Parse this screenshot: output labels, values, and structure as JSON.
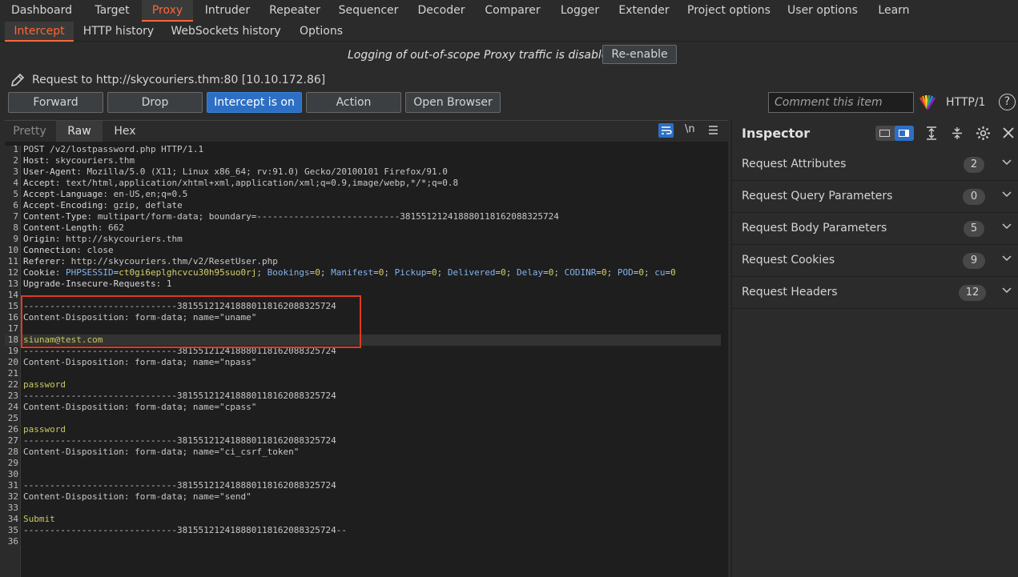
{
  "main_tabs": [
    "Dashboard",
    "Target",
    "Proxy",
    "Intruder",
    "Repeater",
    "Sequencer",
    "Decoder",
    "Comparer",
    "Logger",
    "Extender",
    "Project options",
    "User options",
    "Learn"
  ],
  "sub_tabs": [
    "Intercept",
    "HTTP history",
    "WebSockets history",
    "Options"
  ],
  "logging": {
    "text": "Logging of out-of-scope Proxy traffic is disabled",
    "reenable": "Re-enable"
  },
  "request_info": "Request to http://skycouriers.thm:80  [10.10.172.86]",
  "toolbar": {
    "forward": "Forward",
    "drop": "Drop",
    "intercept": "Intercept is on",
    "action": "Action",
    "open_browser": "Open Browser",
    "comment_placeholder": "Comment this item",
    "http_version": "HTTP/1",
    "help": "?"
  },
  "editor_tabs": [
    "Pretty",
    "Raw",
    "Hex"
  ],
  "editor_tools": {
    "newline": "\\n"
  },
  "request": {
    "request_line": "POST /v2/lostpassword.php HTTP/1.1",
    "headers": [
      {
        "k": "Host",
        "v": "skycouriers.thm"
      },
      {
        "k": "User-Agent",
        "v": "Mozilla/5.0 (X11; Linux x86_64; rv:91.0) Gecko/20100101 Firefox/91.0"
      },
      {
        "k": "Accept",
        "v": "text/html,application/xhtml+xml,application/xml;q=0.9,image/webp,*/*;q=0.8"
      },
      {
        "k": "Accept-Language",
        "v": "en-US,en;q=0.5"
      },
      {
        "k": "Accept-Encoding",
        "v": "gzip, deflate"
      },
      {
        "k": "Content-Type",
        "v": "multipart/form-data; boundary=---------------------------381551212418880118162088325724"
      },
      {
        "k": "Content-Length",
        "v": "662"
      },
      {
        "k": "Origin",
        "v": "http://skycouriers.thm"
      },
      {
        "k": "Connection",
        "v": "close"
      },
      {
        "k": "Referer",
        "v": "http://skycouriers.thm/v2/ResetUser.php"
      }
    ],
    "cookie_key": "Cookie",
    "cookies": [
      {
        "k": "PHPSESSID",
        "v": "ct0gi6eplghcvcu30h95suo0rj"
      },
      {
        "k": "Bookings",
        "v": "0"
      },
      {
        "k": "Manifest",
        "v": "0"
      },
      {
        "k": "Pickup",
        "v": "0"
      },
      {
        "k": "Delivered",
        "v": "0"
      },
      {
        "k": "Delay",
        "v": "0"
      },
      {
        "k": "CODINR",
        "v": "0"
      },
      {
        "k": "POD",
        "v": "0"
      },
      {
        "k": "cu",
        "v": "0"
      }
    ],
    "upgrade": {
      "k": "Upgrade-Insecure-Requests",
      "v": "1"
    },
    "boundary": "-----------------------------381551212418880118162088325724",
    "boundary_end": "-----------------------------381551212418880118162088325724--",
    "parts": [
      {
        "disposition": "Content-Disposition: form-data; name=\"uname\"",
        "value": "siunam@test.com"
      },
      {
        "disposition": "Content-Disposition: form-data; name=\"npass\"",
        "value": "password"
      },
      {
        "disposition": "Content-Disposition: form-data; name=\"cpass\"",
        "value": "password"
      },
      {
        "disposition": "Content-Disposition: form-data; name=\"ci_csrf_token\"",
        "value": ""
      },
      {
        "disposition": "Content-Disposition: form-data; name=\"send\"",
        "value": "Submit"
      }
    ]
  },
  "inspector": {
    "title": "Inspector",
    "rows": [
      {
        "label": "Request Attributes",
        "count": "2"
      },
      {
        "label": "Request Query Parameters",
        "count": "0"
      },
      {
        "label": "Request Body Parameters",
        "count": "5"
      },
      {
        "label": "Request Cookies",
        "count": "9"
      },
      {
        "label": "Request Headers",
        "count": "12"
      }
    ]
  }
}
